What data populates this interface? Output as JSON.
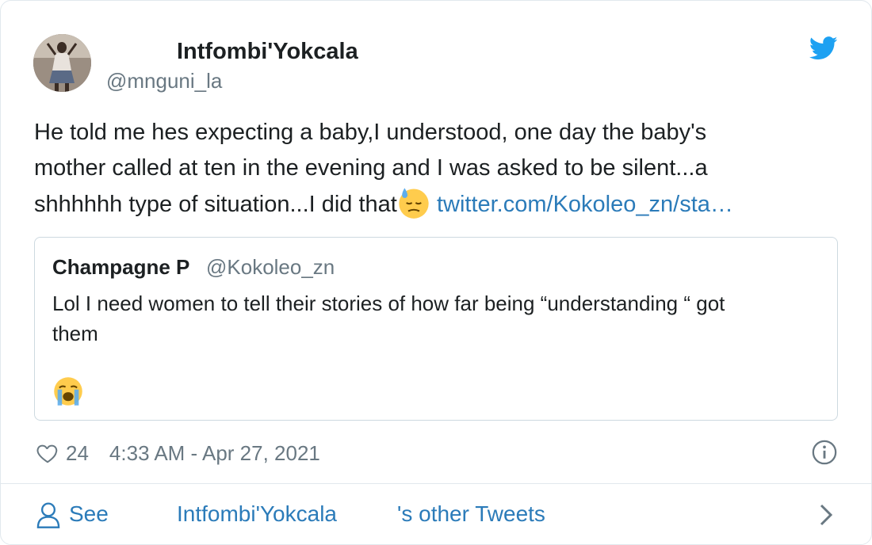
{
  "author": {
    "name": "Intfombi'Yokcala",
    "handle": "@mnguni_la",
    "avatar_icon": "profile-photo"
  },
  "brand": {
    "icon": "twitter-bird-icon",
    "color": "#1da1f2"
  },
  "tweet": {
    "lines": [
      "He told me hes expecting a baby,I understood, one day the baby's",
      "mother called at ten in the evening and I was asked to be silent...a",
      "shhhhhh type of situation...I did that"
    ],
    "emoji": "downcast-face-with-sweat",
    "link": "twitter.com/Kokoleo_zn/sta…"
  },
  "quote": {
    "name": "Champagne P",
    "handle": "@Kokoleo_zn",
    "lines": [
      "Lol I need women to tell their stories of how far being “understanding “ got",
      "them"
    ],
    "emoji": "loudly-crying-face"
  },
  "meta": {
    "likes": "24",
    "timestamp": "4:33 AM - Apr 27, 2021"
  },
  "footer": {
    "see": "See",
    "name": "Intfombi'Yokcala",
    "rest": "'s other Tweets"
  },
  "colors": {
    "text": "#1c2022",
    "secondary": "#697882",
    "link": "#2b7bb9",
    "border": "#e1e8ed"
  }
}
